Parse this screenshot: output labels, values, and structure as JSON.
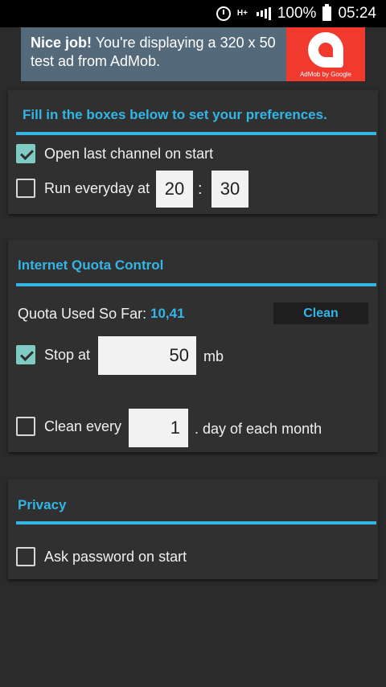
{
  "status_bar": {
    "battery": "100%",
    "time": "05:24",
    "network": "H+"
  },
  "ad": {
    "bold": "Nice job!",
    "text": " You're displaying a 320 x 50 test ad from AdMob.",
    "caption": "AdMob by Google"
  },
  "prefs": {
    "title": "Fill in the boxes below to set your preferences.",
    "open_last_channel": "Open last channel on start",
    "run_everyday": "Run everyday at",
    "hour": "20",
    "separator": ":",
    "minute": "30"
  },
  "quota": {
    "title": "Internet Quota Control",
    "used_label": "Quota Used So Far:",
    "used_value": "10,41",
    "clean_button": "Clean",
    "stop_at": "Stop at",
    "stop_value": "50",
    "unit": "mb",
    "clean_every": "Clean every",
    "day_value": "1",
    "day_suffix": ". day of each month"
  },
  "privacy": {
    "title": "Privacy",
    "ask_password": "Ask password on start"
  },
  "colors": {
    "accent": "#33b5e5",
    "checkbox_checked": "#80cbc4",
    "background": "#2b2b2b"
  }
}
